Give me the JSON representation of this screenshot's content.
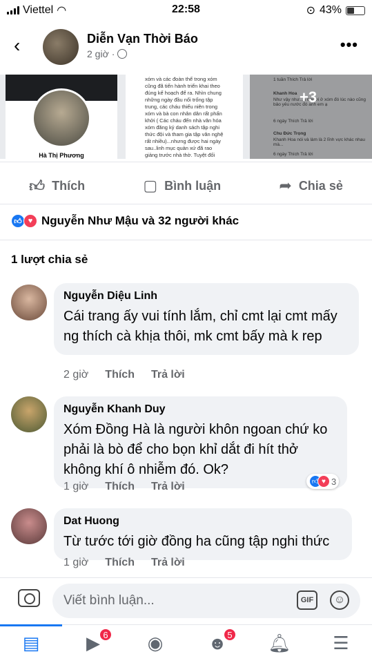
{
  "status_bar": {
    "carrier": "Viettel",
    "time": "22:58",
    "battery": "43%",
    "battery_level": 0.43
  },
  "header": {
    "page_name": "Diễn Vạn Thời Báo",
    "time": "2 giờ",
    "separator": "·"
  },
  "photos": {
    "photo1_caption": "Hà Thị Phương",
    "photo2_text": "xóm và các đoàn thể trong xóm cũng đã tiến hành triển khai theo đúng kế hoạch để ra. Nhìn chung những ngày đầu nổi trống tập trung, các cháu thiếu niên trong xóm và bà con nhân dân rất phấn khởi ( Các cháu đến nhà văn hóa xóm đăng ký danh sách tập nghi thức đội và tham gia tập văn nghệ rất nhiều)...nhưng được hai ngày sau..linh mục quản xứ đã rao giảng trước nhà thờ. Tuyệt đối không cho các cháu tham gia tập thi nghi thức đội và thi biểu diễn văn nghệ nên.....",
    "photo3_lines": [
      "1 tuần   Thích   Trả lời",
      "Khanh Hoa",
      "Như vậy như...a người ở xóm đó lúc nào cũng bảo yêu nước đó anh em ạ",
      "6 ngày   Thích   Trả lời",
      "Chu Đức Trọng",
      "Khanh Hoa nói và làm là 2 lĩnh vực khác nhau mà...",
      "6 ngày   Thích   Trả lời"
    ],
    "photo3_more": "+3"
  },
  "actions": {
    "like": "Thích",
    "comment": "Bình luận",
    "share": "Chia sẻ"
  },
  "reactions_summary": "Nguyễn Như Mậu và 32 người khác",
  "shares": "1 lượt chia sẻ",
  "comments": [
    {
      "name": "Nguyễn Diệu Linh",
      "text": "Cái trang ấy vui tính lắm,  chỉ cmt lại cmt mấy ng thích cà khịa thôi,  mk cmt bấy mà k rep",
      "time": "2 giờ",
      "like": "Thích",
      "reply": "Trả lời"
    },
    {
      "name": "Nguyễn Khanh Duy",
      "text": "Xóm Đồng Hà là người khôn ngoan chứ ko phải là bò để cho bọn khỉ dắt đi hít thở không khí ô nhiễm đó. Ok?",
      "time": "1 giờ",
      "like": "Thích",
      "reply": "Trả lời",
      "reaction_count": "3"
    },
    {
      "name": "Dat Huong",
      "text": "Từ tước tới giờ đồng ha cũng tập nghi thức",
      "time": "1 giờ",
      "like": "Thích",
      "reply": "Trả lời"
    }
  ],
  "composer": {
    "placeholder": "Viết bình luận...",
    "gif": "GIF"
  },
  "tabbar": {
    "watch_badge": "6",
    "groups_badge": "5"
  },
  "colors": {
    "accent": "#1877f2",
    "badge": "#f02849",
    "bubble": "#f0f2f5"
  }
}
